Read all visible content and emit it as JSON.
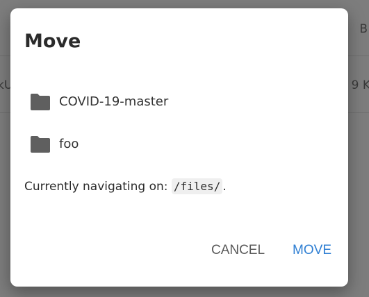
{
  "background": {
    "right_top_text": "B",
    "left_mid_text": "kU",
    "right_mid_text": "9 K"
  },
  "dialog": {
    "title": "Move",
    "folders": [
      {
        "label": "COVID-19-master",
        "icon": "folder-icon"
      },
      {
        "label": "foo",
        "icon": "folder-icon"
      }
    ],
    "nav_prefix": "Currently navigating on: ",
    "nav_path": "/files/",
    "nav_suffix": ".",
    "cancel_label": "CANCEL",
    "move_label": "MOVE"
  },
  "colors": {
    "accent": "#2f7fd3",
    "folder_icon": "#5f5f5f",
    "overlay": "#7d7d7d"
  }
}
